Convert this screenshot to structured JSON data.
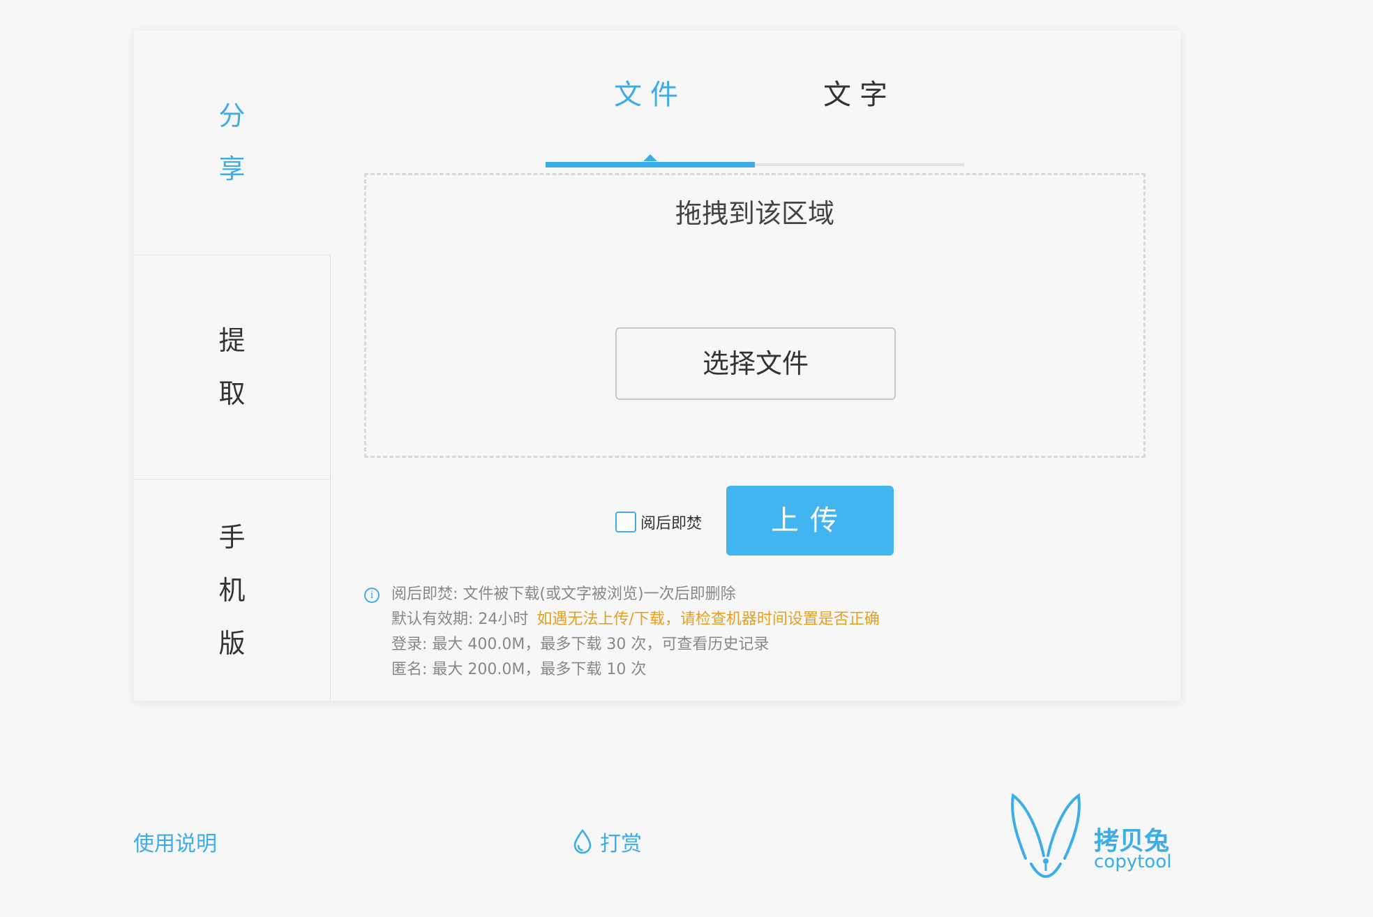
{
  "sidebar": {
    "share": [
      "分",
      "享"
    ],
    "extract": [
      "提",
      "取"
    ],
    "mobile": [
      "手",
      "机",
      "版"
    ]
  },
  "tabs": {
    "file": "文件",
    "text": "文字"
  },
  "dropzone": {
    "title": "拖拽到该区域",
    "choose_button": "选择文件"
  },
  "upload": {
    "burn_after_read_label": "阅后即焚",
    "burn_after_read_checked": false,
    "button": "上传"
  },
  "info": {
    "line1": "阅后即焚: 文件被下载(或文字被浏览)一次后即删除",
    "line2_prefix": "默认有效期: 24小时",
    "line2_warning": "如遇无法上传/下载，请检查机器时间设置是否正确",
    "line3": "登录: 最大 400.0M，最多下载 30 次，可查看历史记录",
    "line4": "匿名: 最大 200.0M，最多下载 10 次"
  },
  "footer": {
    "help": "使用说明",
    "tip": "打赏"
  },
  "logo": {
    "cn": "拷贝兔",
    "en": "copytool"
  },
  "colors": {
    "accent": "#3cade8",
    "upload_button": "#42b4ef",
    "warning": "#e6a020"
  }
}
